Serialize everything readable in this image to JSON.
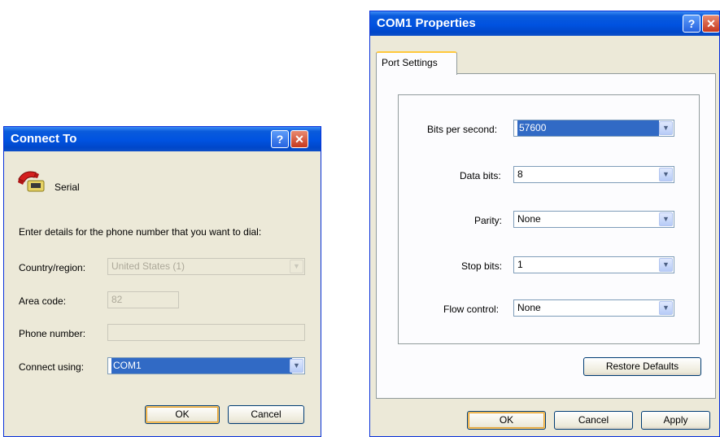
{
  "connect_dialog": {
    "title": "Connect To",
    "help_glyph": "?",
    "close_glyph": "✕",
    "connection_name": "Serial",
    "connection_icon": "telephone-icon",
    "instructions": "Enter details for the phone number that you want to dial:",
    "country_label": "Country/region:",
    "country_value": "United States (1)",
    "area_code_label": "Area code:",
    "area_code_value": "82",
    "phone_label": "Phone number:",
    "phone_value": "",
    "connect_using_label": "Connect using:",
    "connect_using_value": "COM1",
    "ok_label": "OK",
    "cancel_label": "Cancel"
  },
  "properties_dialog": {
    "title": "COM1 Properties",
    "help_glyph": "?",
    "close_glyph": "✕",
    "tab_label": "Port Settings",
    "bits_per_second_label": "Bits per second:",
    "bits_per_second_value": "57600",
    "data_bits_label": "Data bits:",
    "data_bits_value": "8",
    "parity_label": "Parity:",
    "parity_value": "None",
    "stop_bits_label": "Stop bits:",
    "stop_bits_value": "1",
    "flow_control_label": "Flow control:",
    "flow_control_value": "None",
    "restore_defaults_label": "Restore Defaults",
    "ok_label": "OK",
    "cancel_label": "Cancel",
    "apply_label": "Apply"
  },
  "dropdown_glyph": "▼",
  "colors": {
    "title_bar": "#0052e0",
    "selection": "#316ac5",
    "dialog_bg": "#ece9d8",
    "close_button": "#c6381e"
  }
}
